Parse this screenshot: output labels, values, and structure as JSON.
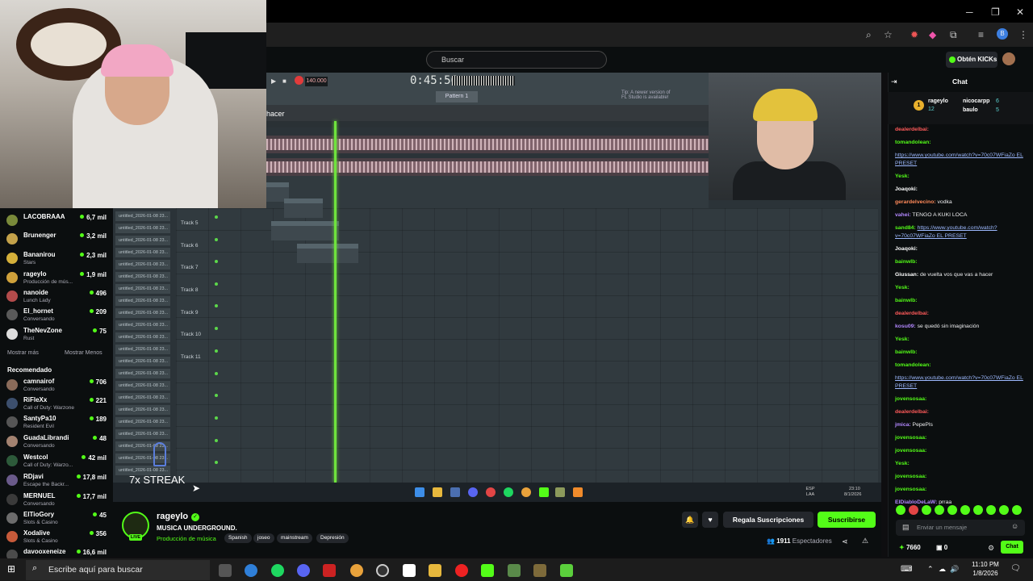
{
  "browser": {
    "window_controls": [
      "─",
      "❐",
      "✕"
    ]
  },
  "kick": {
    "search_placeholder": "Buscar",
    "get_kicks": "Obtén KICKs"
  },
  "fl": {
    "tempo": "140.000",
    "time": "0:45:56",
    "pattern": "Pattern 1",
    "hint": "Tip: A newer version of FL Studio is available!",
    "hacer": "hacer",
    "track_labels": [
      "Track 5",
      "Track 6",
      "Track 7",
      "Track 8",
      "Track 9",
      "Track 10",
      "Track 11"
    ],
    "file_item": "untitled_2026-01-08 23..."
  },
  "overlay": {
    "streak": "7x STREAK"
  },
  "sidebar": {
    "following": [
      {
        "name": "LACOBRAAA",
        "cat": "",
        "viewers": "6,7 mil"
      },
      {
        "name": "Brunenger",
        "cat": "",
        "viewers": "3,2 mil"
      },
      {
        "name": "Bananirou",
        "cat": "Stars",
        "viewers": "2,3 mil"
      },
      {
        "name": "rageylo",
        "cat": "Producción de mús...",
        "viewers": "1,9 mil"
      },
      {
        "name": "nanoide",
        "cat": "Lunch Lady",
        "viewers": "496"
      },
      {
        "name": "El_hornet",
        "cat": "Conversando",
        "viewers": "209"
      },
      {
        "name": "TheNevZone",
        "cat": "Rust",
        "viewers": "75"
      }
    ],
    "show_more": "Mostrar más",
    "show_less": "Mostrar Menos",
    "recommended_title": "Recomendado",
    "recommended": [
      {
        "name": "camnairof",
        "cat": "Conversando",
        "viewers": "706"
      },
      {
        "name": "RiFleXx",
        "cat": "Call of Duty: Warzone",
        "viewers": "221"
      },
      {
        "name": "SantyPa10",
        "cat": "Resident Evil",
        "viewers": "189"
      },
      {
        "name": "GuadaLibrandi",
        "cat": "Conversando",
        "viewers": "48"
      },
      {
        "name": "Westcol",
        "cat": "Call of Duty: Warzo...",
        "viewers": "42 mil"
      },
      {
        "name": "RDjavi",
        "cat": "Escape the Backr...",
        "viewers": "17,8 mil"
      },
      {
        "name": "MERNUEL",
        "cat": "Conversando",
        "viewers": "17,7 mil"
      },
      {
        "name": "ElTioGory",
        "cat": "Slots & Casino",
        "viewers": "45"
      },
      {
        "name": "Xodalive",
        "cat": "Slots & Casino",
        "viewers": "356"
      },
      {
        "name": "davooxeneize",
        "cat": "",
        "viewers": "16,6 mil"
      }
    ]
  },
  "stream": {
    "name": "rageylo",
    "title": "MUSICA UNDERGROUND.",
    "category": "Producción de música",
    "tags": [
      "Spanish",
      "joseo",
      "mainstream",
      "Depresión"
    ],
    "gift": "Regala Suscripciones",
    "subscribe": "Suscribirse",
    "viewers": "1911",
    "viewers_label": "Espectadores"
  },
  "chat": {
    "title": "Chat",
    "gifters": [
      {
        "name": "rageylo",
        "val": "12"
      },
      {
        "name": "nicocarpp",
        "val": "6"
      },
      {
        "name": "baulo",
        "val": "5"
      }
    ],
    "messages": [
      {
        "user": "dealerdelbai:",
        "text": "",
        "color": "#ff5a5a"
      },
      {
        "user": "tomandolean:",
        "text": "",
        "color": "#53fc18"
      },
      {
        "user": "",
        "text": "https://www.youtube.com/watch?v=70c07WFiaZo EL PRESET",
        "color": "#9db9ff"
      },
      {
        "user": "Yesk:",
        "text": "",
        "color": "#53fc18"
      },
      {
        "user": "Joaqoki:",
        "text": "",
        "color": "#ffffff"
      },
      {
        "user": "gerardelvecino:",
        "text": "vodka",
        "color": "#ff8a5a"
      },
      {
        "user": "vahei:",
        "text": "TENGO A KUKI LOCA",
        "color": "#b388ff"
      },
      {
        "user": "sand84:",
        "text": "https://www.youtube.com/watch?v=70c07WFiaZo EL PRESET",
        "color": "#53fc18"
      },
      {
        "user": "Joaqoki:",
        "text": "",
        "color": "#ffffff"
      },
      {
        "user": "bainwlb:",
        "text": "",
        "color": "#53fc18"
      },
      {
        "user": "Giussan:",
        "text": "de vuelta vos que vas a hacer",
        "color": "#ffffff"
      },
      {
        "user": "Yesk:",
        "text": "",
        "color": "#53fc18"
      },
      {
        "user": "bainwlb:",
        "text": "",
        "color": "#53fc18"
      },
      {
        "user": "dealerdelbai:",
        "text": "",
        "color": "#ff5a5a"
      },
      {
        "user": "kosu09:",
        "text": "se quedó sin imaginación",
        "color": "#b388ff"
      },
      {
        "user": "Yesk:",
        "text": "",
        "color": "#53fc18"
      },
      {
        "user": "bainwlb:",
        "text": "",
        "color": "#53fc18"
      },
      {
        "user": "tomandolean:",
        "text": "",
        "color": "#53fc18"
      },
      {
        "user": "",
        "text": "https://www.youtube.com/watch?v=70c07WFiaZo EL PRESET",
        "color": "#9db9ff"
      },
      {
        "user": "jovensosaa:",
        "text": "",
        "color": "#53fc18"
      },
      {
        "user": "dealerdelbai:",
        "text": "",
        "color": "#ff5a5a"
      },
      {
        "user": "jmica:",
        "text": "PepePls",
        "color": "#b388ff"
      },
      {
        "user": "jovensosaa:",
        "text": "",
        "color": "#53fc18"
      },
      {
        "user": "jovensosaa:",
        "text": "",
        "color": "#53fc18"
      },
      {
        "user": "Yesk:",
        "text": "",
        "color": "#53fc18"
      },
      {
        "user": "jovensosaa:",
        "text": "",
        "color": "#53fc18"
      },
      {
        "user": "jovensosaa:",
        "text": "",
        "color": "#53fc18"
      },
      {
        "user": "ElDiabloDeLaW:",
        "text": "prraa",
        "color": "#b388ff"
      }
    ],
    "input_placeholder": "Enviar un mensaje",
    "points": "7660",
    "count": "0",
    "send": "Chat"
  },
  "taskbar": {
    "search": "Escribe aquí para buscar",
    "lang": "ESP LAA",
    "time": "11:10 PM",
    "date": "1/8/2026"
  },
  "inner_clock": {
    "time": "23:10",
    "date": "8/1/2026",
    "lang": "ESP LAA"
  }
}
